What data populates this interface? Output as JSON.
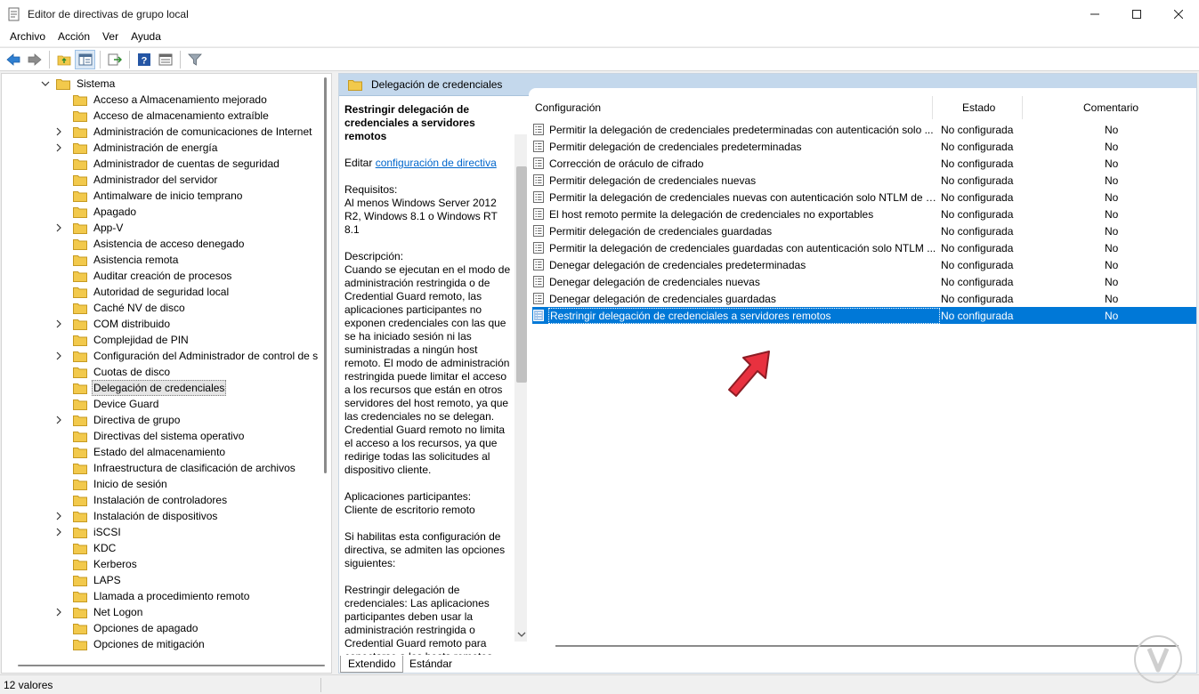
{
  "window": {
    "title": "Editor de directivas de grupo local",
    "controls": {
      "minimize": "minimize-icon",
      "maximize": "maximize-icon",
      "close": "close-icon"
    }
  },
  "menu": [
    "Archivo",
    "Acción",
    "Ver",
    "Ayuda"
  ],
  "toolbar": [
    "back-arrow-icon",
    "forward-arrow-icon",
    "up-folder-icon",
    "show-hide-tree-icon",
    "export-list-icon",
    "help-icon",
    "properties-icon",
    "filter-icon"
  ],
  "tree": {
    "root": "Sistema",
    "items": [
      {
        "label": "Acceso a Almacenamiento mejorado",
        "expandable": false
      },
      {
        "label": "Acceso de almacenamiento extraíble",
        "expandable": false
      },
      {
        "label": "Administración de comunicaciones de Internet",
        "expandable": true
      },
      {
        "label": "Administración de energía",
        "expandable": true
      },
      {
        "label": "Administrador de cuentas de seguridad",
        "expandable": false
      },
      {
        "label": "Administrador del servidor",
        "expandable": false
      },
      {
        "label": "Antimalware de inicio temprano",
        "expandable": false
      },
      {
        "label": "Apagado",
        "expandable": false
      },
      {
        "label": "App-V",
        "expandable": true
      },
      {
        "label": "Asistencia de acceso denegado",
        "expandable": false
      },
      {
        "label": "Asistencia remota",
        "expandable": false
      },
      {
        "label": "Auditar creación de procesos",
        "expandable": false
      },
      {
        "label": "Autoridad de seguridad local",
        "expandable": false
      },
      {
        "label": "Caché NV de disco",
        "expandable": false
      },
      {
        "label": "COM distribuido",
        "expandable": true
      },
      {
        "label": "Complejidad de PIN",
        "expandable": false
      },
      {
        "label": "Configuración del Administrador de control de s",
        "expandable": true
      },
      {
        "label": "Cuotas de disco",
        "expandable": false
      },
      {
        "label": "Delegación de credenciales",
        "expandable": false,
        "selected": true
      },
      {
        "label": "Device Guard",
        "expandable": false
      },
      {
        "label": "Directiva de grupo",
        "expandable": true
      },
      {
        "label": "Directivas del sistema operativo",
        "expandable": false
      },
      {
        "label": "Estado del almacenamiento",
        "expandable": false
      },
      {
        "label": "Infraestructura de clasificación de archivos",
        "expandable": false
      },
      {
        "label": "Inicio de sesión",
        "expandable": false
      },
      {
        "label": "Instalación de controladores",
        "expandable": false
      },
      {
        "label": "Instalación de dispositivos",
        "expandable": true
      },
      {
        "label": "iSCSI",
        "expandable": true
      },
      {
        "label": "KDC",
        "expandable": false
      },
      {
        "label": "Kerberos",
        "expandable": false
      },
      {
        "label": "LAPS",
        "expandable": false
      },
      {
        "label": "Llamada a procedimiento remoto",
        "expandable": false
      },
      {
        "label": "Net Logon",
        "expandable": true
      },
      {
        "label": "Opciones de apagado",
        "expandable": false
      },
      {
        "label": "Opciones de mitigación",
        "expandable": false
      }
    ]
  },
  "right_header": {
    "title": "Delegación de credenciales"
  },
  "description": {
    "title": "Restringir delegación de credenciales a servidores remotos",
    "edit_prefix": "Editar ",
    "edit_link": "configuración de directiva",
    "requirements_label": "Requisitos:",
    "requirements": "Al menos Windows Server 2012 R2, Windows 8.1 o Windows RT 8.1",
    "description_label": "Descripción:",
    "description": "Cuando se ejecutan en el modo de administración restringida o de Credential Guard remoto, las aplicaciones participantes no exponen credenciales con las que se ha iniciado sesión ni las suministradas a ningún host remoto. El modo de administración restringida puede limitar el acceso a los recursos que están en otros servidores del host remoto, ya que las credenciales no se delegan. Credential Guard remoto no limita el acceso a los recursos, ya que redirige todas las solicitudes al dispositivo cliente.",
    "apps_label": "Aplicaciones participantes:",
    "apps": "Cliente de escritorio remoto",
    "options_text": "Si habilitas esta configuración de directiva, se admiten las opciones siguientes:",
    "restrict_text": "Restringir delegación de credenciales: Las aplicaciones participantes deben usar la administración restringida o Credential Guard remoto para conectarse a los hosts remotos."
  },
  "list": {
    "columns": {
      "name": "Configuración",
      "state": "Estado",
      "comment": "Comentario"
    },
    "rows": [
      {
        "name": "Permitir la delegación de credenciales predeterminadas con autenticación solo ...",
        "state": "No configurada",
        "comment": "No"
      },
      {
        "name": "Permitir delegación de credenciales predeterminadas",
        "state": "No configurada",
        "comment": "No"
      },
      {
        "name": "Corrección de oráculo de cifrado",
        "state": "No configurada",
        "comment": "No"
      },
      {
        "name": "Permitir delegación de credenciales nuevas",
        "state": "No configurada",
        "comment": "No"
      },
      {
        "name": "Permitir la delegación de credenciales nuevas con autenticación solo NTLM de s...",
        "state": "No configurada",
        "comment": "No"
      },
      {
        "name": "El host remoto permite la delegación de credenciales no exportables",
        "state": "No configurada",
        "comment": "No"
      },
      {
        "name": "Permitir delegación de credenciales guardadas",
        "state": "No configurada",
        "comment": "No"
      },
      {
        "name": "Permitir la delegación de credenciales guardadas con autenticación solo NTLM ...",
        "state": "No configurada",
        "comment": "No"
      },
      {
        "name": "Denegar delegación de credenciales predeterminadas",
        "state": "No configurada",
        "comment": "No"
      },
      {
        "name": "Denegar delegación de credenciales nuevas",
        "state": "No configurada",
        "comment": "No"
      },
      {
        "name": "Denegar delegación de credenciales guardadas",
        "state": "No configurada",
        "comment": "No"
      },
      {
        "name": "Restringir delegación de credenciales a servidores remotos",
        "state": "No configurada",
        "comment": "No",
        "selected": true
      }
    ]
  },
  "tabs": [
    "Extendido",
    "Estándar"
  ],
  "status": {
    "text": "12 valores"
  },
  "colors": {
    "selection": "#0078d7",
    "header_band": "#c4d8ec",
    "folder": "#f2c94c",
    "arrow": "#e8313f"
  }
}
